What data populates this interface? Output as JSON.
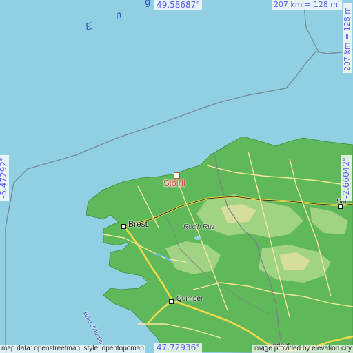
{
  "map": {
    "coords": {
      "top": "49.58687°",
      "bottom": "47.72936°",
      "left": "-5.47292°",
      "right": "-2.66042°"
    },
    "scale_top": "207 km = 128 mi",
    "scale_side": "207 km = 128 mi",
    "credits": {
      "left": "map data: openstreetmap, style: opentopomap",
      "right": "image provided by elevation.city"
    },
    "target": {
      "name": "Sibiril",
      "color": "#d9463c"
    },
    "towns": {
      "brest": "Brest",
      "quimper": "Quimper",
      "lorient": "Lorient",
      "sai": "Sai"
    },
    "features": {
      "peak": "Roc'h Ruz",
      "baie": "Baie d'Audierne"
    },
    "sea_letters": {
      "e": "E",
      "n": "n",
      "g": "g"
    },
    "colors": {
      "sea": "#91cfe2",
      "land_low": "#5fb95a",
      "land_mid": "#a9d68a",
      "land_high": "#d6dd9d",
      "roads": "#f2d94a",
      "borders": "#7d7d8a"
    }
  }
}
